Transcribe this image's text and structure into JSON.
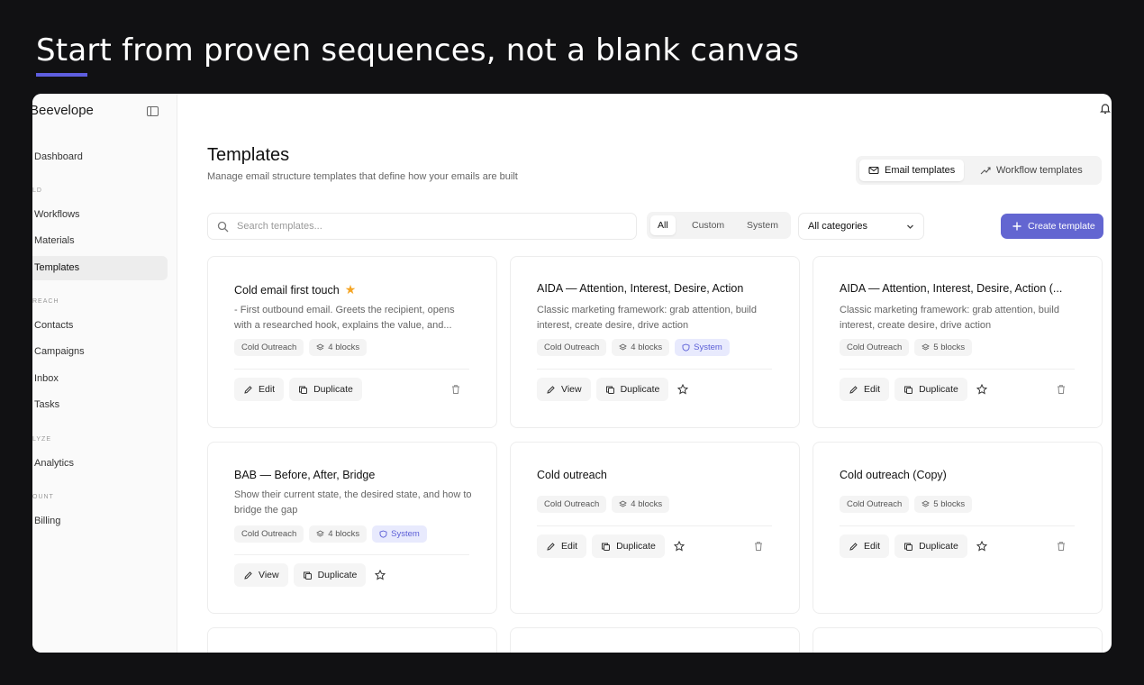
{
  "hero": {
    "title": "Start from proven sequences, not a blank canvas"
  },
  "colors": {
    "accent": "#6366d1",
    "star": "#f5a524",
    "system_tag_bg": "#e8eafd",
    "system_tag_text": "#5b5ed6"
  },
  "sidebar": {
    "brand": "Beevelope",
    "items": {
      "dashboard": "Dashboard",
      "workflows": "Workflows",
      "materials": "Materials",
      "templates": "Templates",
      "contacts": "Contacts",
      "campaigns": "Campaigns",
      "inbox": "Inbox",
      "tasks": "Tasks",
      "analytics": "Analytics",
      "billing": "Billing"
    },
    "sections": {
      "build": "LD",
      "outreach": "REACH",
      "analyze": "LYZE",
      "account": "OUNT"
    }
  },
  "header": {
    "title": "Templates",
    "subtitle": "Manage email structure templates that define how your emails are built",
    "tabs": {
      "email": "Email templates",
      "workflow": "Workflow templates"
    }
  },
  "toolbar": {
    "search_placeholder": "Search templates...",
    "filters": {
      "all": "All",
      "custom": "Custom",
      "system": "System"
    },
    "category": "All categories",
    "create_label": "Create template"
  },
  "cards": [
    {
      "title": "Cold email first touch",
      "desc": "- First outbound email. Greets the recipient, opens with a researched hook, explains the value, and...",
      "category": "Cold Outreach",
      "blocks": "4 blocks",
      "primary": "Edit",
      "duplicate": "Duplicate"
    },
    {
      "title": "AIDA — Attention, Interest, Desire, Action",
      "desc": "Classic marketing framework: grab attention, build interest, create desire, drive action",
      "category": "Cold Outreach",
      "blocks": "4 blocks",
      "system": "System",
      "primary": "View",
      "duplicate": "Duplicate"
    },
    {
      "title": "AIDA — Attention, Interest, Desire, Action (...",
      "desc": "Classic marketing framework: grab attention, build interest, create desire, drive action",
      "category": "Cold Outreach",
      "blocks": "5 blocks",
      "primary": "Edit",
      "duplicate": "Duplicate"
    },
    {
      "title": "BAB — Before, After, Bridge",
      "desc": "Show their current state, the desired state, and how to bridge the gap",
      "category": "Cold Outreach",
      "blocks": "4 blocks",
      "system": "System",
      "primary": "View",
      "duplicate": "Duplicate"
    },
    {
      "title": "Cold outreach",
      "category": "Cold Outreach",
      "blocks": "4 blocks",
      "primary": "Edit",
      "duplicate": "Duplicate"
    },
    {
      "title": "Cold outreach (Copy)",
      "category": "Cold Outreach",
      "blocks": "5 blocks",
      "primary": "Edit",
      "duplicate": "Duplicate"
    }
  ]
}
